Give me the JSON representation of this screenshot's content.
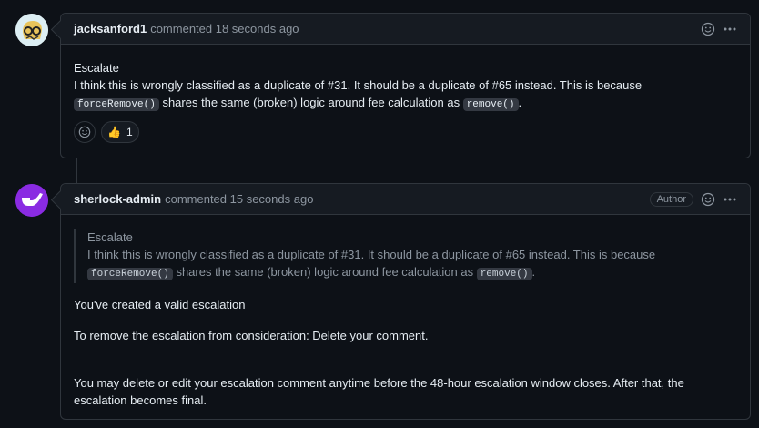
{
  "comment1": {
    "author": "jacksanford1",
    "meta": "commented 18 seconds ago",
    "line1": "Escalate",
    "line2": "I think this is wrongly classified as a duplicate of #31. It should be a duplicate of #65 instead. This is because",
    "code1": "forceRemove()",
    "mid": " shares the same (broken) logic around fee calculation as ",
    "code2": "remove()",
    "end": ".",
    "reaction": {
      "emoji": "👍",
      "count": "1"
    }
  },
  "comment2": {
    "author": "sherlock-admin",
    "meta": "commented 15 seconds ago",
    "badge": "Author",
    "quote_line1": "Escalate",
    "quote_line2": "I think this is wrongly classified as a duplicate of #31. It should be a duplicate of #65 instead. This is because",
    "quote_code1": "forceRemove()",
    "quote_mid": " shares the same (broken) logic around fee calculation as ",
    "quote_code2": "remove()",
    "quote_end": ".",
    "p1": "You've created a valid escalation",
    "p2": "To remove the escalation from consideration: Delete your comment.",
    "p3": "You may delete or edit your escalation comment anytime before the 48-hour escalation window closes. After that, the escalation becomes final."
  }
}
